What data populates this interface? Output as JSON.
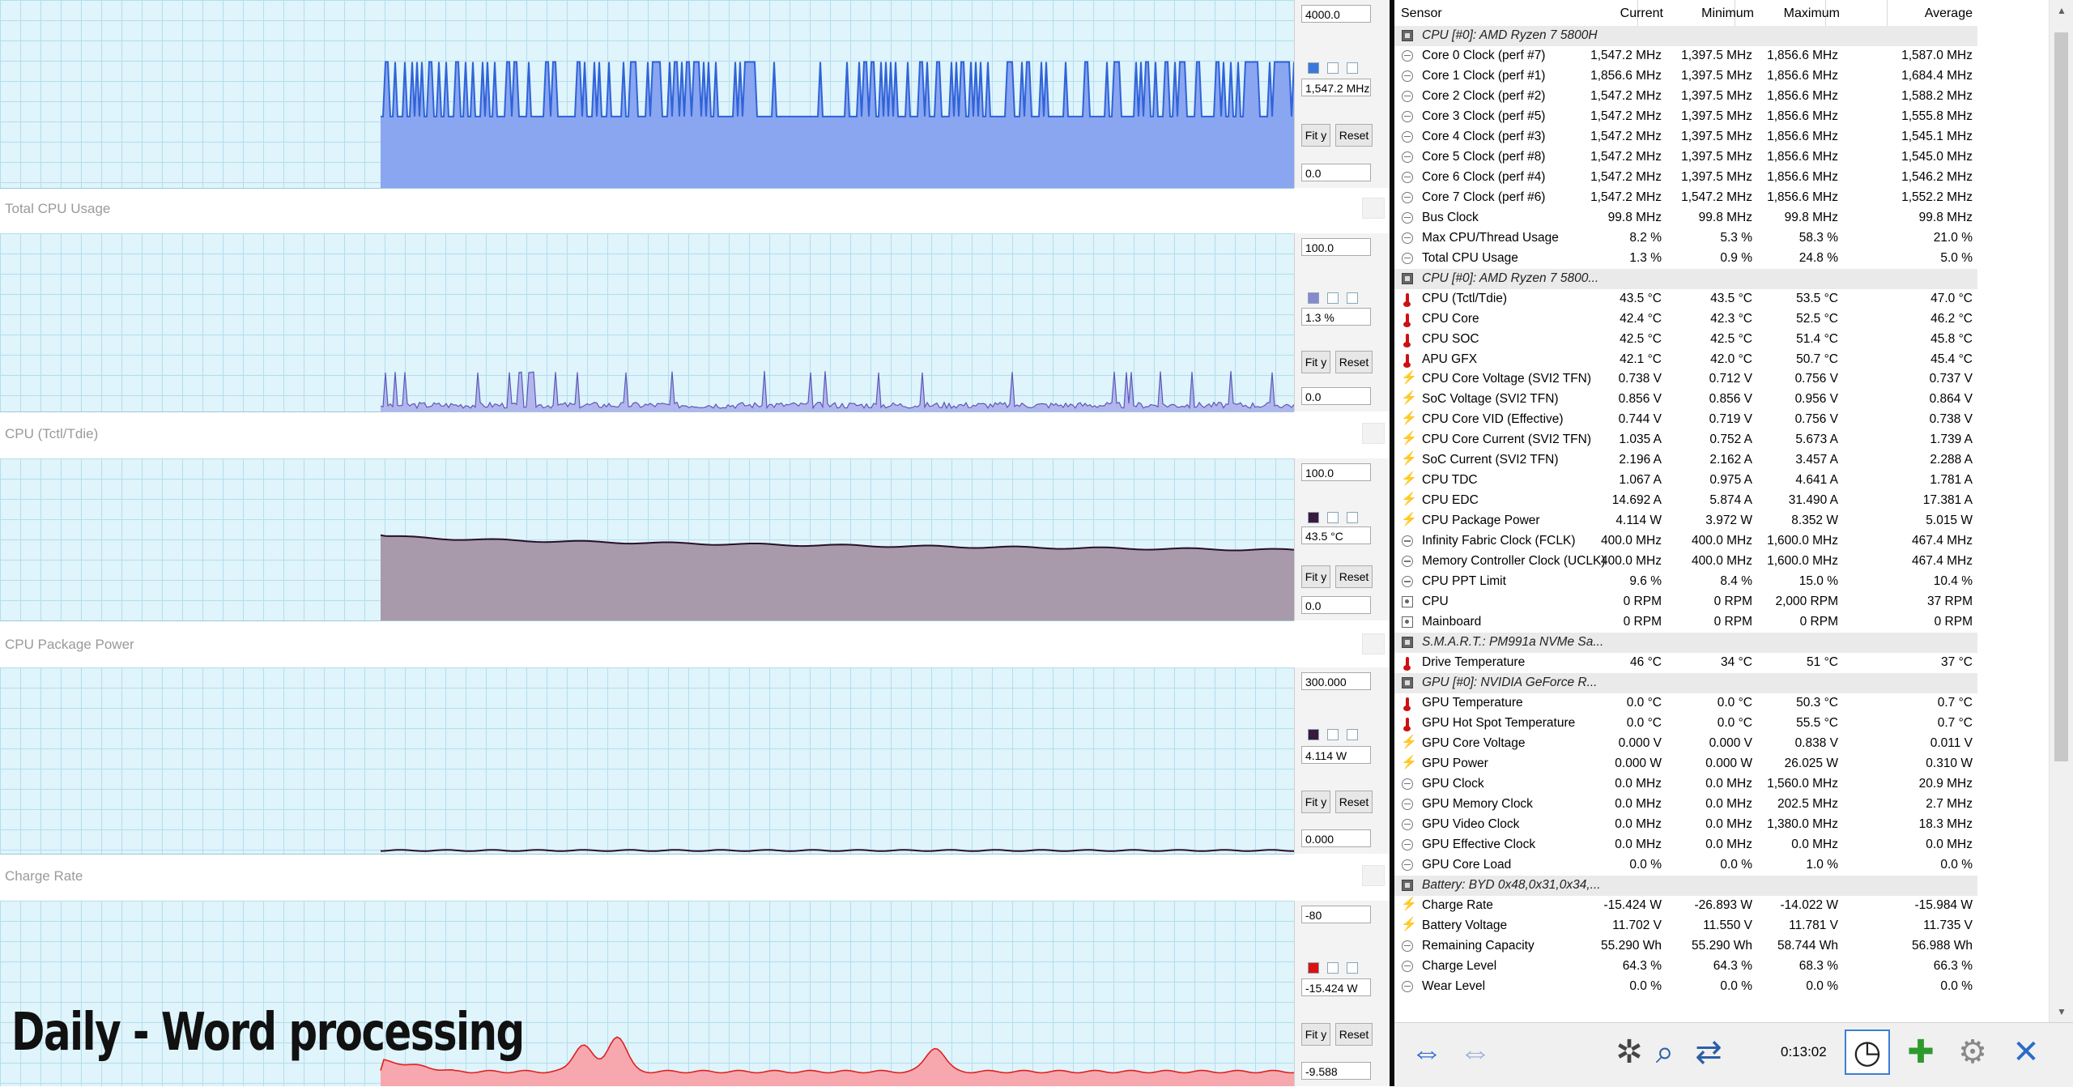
{
  "caption": "Daily - Word processing",
  "graphs": [
    {
      "title": "",
      "max": "4000.0",
      "current": "1,547.2 MHz",
      "min": "0.0",
      "color": "#3b78d8",
      "fit": "Fit y",
      "reset": "Reset"
    },
    {
      "title": "Total CPU Usage",
      "max": "100.0",
      "current": "1.3 %",
      "min": "0.0",
      "color": "#8888cc",
      "fit": "Fit y",
      "reset": "Reset"
    },
    {
      "title": "CPU (Tctl/Tdie)",
      "max": "100.0",
      "current": "43.5 °C",
      "min": "0.0",
      "color": "#3a1a3a",
      "fit": "Fit y",
      "reset": "Reset"
    },
    {
      "title": "CPU Package Power",
      "max": "300.000",
      "current": "4.114 W",
      "min": "0.000",
      "color": "#3a1a3a",
      "fit": "Fit y",
      "reset": "Reset"
    },
    {
      "title": "Charge Rate",
      "max": "-80",
      "current": "-15.424 W",
      "min": "-9.588",
      "color": "#dd1111",
      "fit": "Fit y",
      "reset": "Reset"
    }
  ],
  "table": {
    "headers": [
      "Sensor",
      "Current",
      "Minimum",
      "Maximum",
      "Average"
    ],
    "rows": [
      {
        "type": "group",
        "icon": "chip",
        "name": "CPU [#0]: AMD Ryzen 7 5800H"
      },
      {
        "icon": "clock",
        "name": "Core 0 Clock (perf #7)",
        "v": [
          "1,547.2 MHz",
          "1,397.5 MHz",
          "1,856.6 MHz",
          "1,587.0 MHz"
        ]
      },
      {
        "icon": "clock",
        "name": "Core 1 Clock (perf #1)",
        "v": [
          "1,856.6 MHz",
          "1,397.5 MHz",
          "1,856.6 MHz",
          "1,684.4 MHz"
        ]
      },
      {
        "icon": "clock",
        "name": "Core 2 Clock (perf #2)",
        "v": [
          "1,547.2 MHz",
          "1,397.5 MHz",
          "1,856.6 MHz",
          "1,588.2 MHz"
        ]
      },
      {
        "icon": "clock",
        "name": "Core 3 Clock (perf #5)",
        "v": [
          "1,547.2 MHz",
          "1,397.5 MHz",
          "1,856.6 MHz",
          "1,555.8 MHz"
        ]
      },
      {
        "icon": "clock",
        "name": "Core 4 Clock (perf #3)",
        "v": [
          "1,547.2 MHz",
          "1,397.5 MHz",
          "1,856.6 MHz",
          "1,545.1 MHz"
        ]
      },
      {
        "icon": "clock",
        "name": "Core 5 Clock (perf #8)",
        "v": [
          "1,547.2 MHz",
          "1,397.5 MHz",
          "1,856.6 MHz",
          "1,545.0 MHz"
        ]
      },
      {
        "icon": "clock",
        "name": "Core 6 Clock (perf #4)",
        "v": [
          "1,547.2 MHz",
          "1,397.5 MHz",
          "1,856.6 MHz",
          "1,546.2 MHz"
        ]
      },
      {
        "icon": "clock",
        "name": "Core 7 Clock (perf #6)",
        "v": [
          "1,547.2 MHz",
          "1,547.2 MHz",
          "1,856.6 MHz",
          "1,552.2 MHz"
        ]
      },
      {
        "icon": "clock",
        "name": "Bus Clock",
        "v": [
          "99.8 MHz",
          "99.8 MHz",
          "99.8 MHz",
          "99.8 MHz"
        ]
      },
      {
        "icon": "clock",
        "name": "Max CPU/Thread Usage",
        "v": [
          "8.2 %",
          "5.3 %",
          "58.3 %",
          "21.0 %"
        ]
      },
      {
        "icon": "clock",
        "name": "Total CPU Usage",
        "v": [
          "1.3 %",
          "0.9 %",
          "24.8 %",
          "5.0 %"
        ]
      },
      {
        "type": "group",
        "icon": "chip",
        "name": "CPU [#0]: AMD Ryzen 7 5800..."
      },
      {
        "icon": "temp",
        "name": "CPU (Tctl/Tdie)",
        "v": [
          "43.5 °C",
          "43.5 °C",
          "53.5 °C",
          "47.0 °C"
        ]
      },
      {
        "icon": "temp",
        "name": "CPU Core",
        "v": [
          "42.4 °C",
          "42.3 °C",
          "52.5 °C",
          "46.2 °C"
        ]
      },
      {
        "icon": "temp",
        "name": "CPU SOC",
        "v": [
          "42.5 °C",
          "42.5 °C",
          "51.4 °C",
          "45.8 °C"
        ]
      },
      {
        "icon": "temp",
        "name": "APU GFX",
        "v": [
          "42.1 °C",
          "42.0 °C",
          "50.7 °C",
          "45.4 °C"
        ]
      },
      {
        "icon": "volt",
        "name": "CPU Core Voltage (SVI2 TFN)",
        "v": [
          "0.738 V",
          "0.712 V",
          "0.756 V",
          "0.737 V"
        ]
      },
      {
        "icon": "volt",
        "name": "SoC Voltage (SVI2 TFN)",
        "v": [
          "0.856 V",
          "0.856 V",
          "0.956 V",
          "0.864 V"
        ]
      },
      {
        "icon": "volt",
        "name": "CPU Core VID (Effective)",
        "v": [
          "0.744 V",
          "0.719 V",
          "0.756 V",
          "0.738 V"
        ]
      },
      {
        "icon": "volt",
        "name": "CPU Core Current (SVI2 TFN)",
        "v": [
          "1.035 A",
          "0.752 A",
          "5.673 A",
          "1.739 A"
        ]
      },
      {
        "icon": "volt",
        "name": "SoC Current (SVI2 TFN)",
        "v": [
          "2.196 A",
          "2.162 A",
          "3.457 A",
          "2.288 A"
        ]
      },
      {
        "icon": "volt",
        "name": "CPU TDC",
        "v": [
          "1.067 A",
          "0.975 A",
          "4.641 A",
          "1.781 A"
        ]
      },
      {
        "icon": "volt",
        "name": "CPU EDC",
        "v": [
          "14.692 A",
          "5.874 A",
          "31.490 A",
          "17.381 A"
        ]
      },
      {
        "icon": "volt",
        "name": "CPU Package Power",
        "v": [
          "4.114 W",
          "3.972 W",
          "8.352 W",
          "5.015 W"
        ]
      },
      {
        "icon": "clock",
        "name": "Infinity Fabric Clock (FCLK)",
        "v": [
          "400.0 MHz",
          "400.0 MHz",
          "1,600.0 MHz",
          "467.4 MHz"
        ]
      },
      {
        "icon": "clock",
        "name": "Memory Controller Clock (UCLK)",
        "v": [
          "400.0 MHz",
          "400.0 MHz",
          "1,600.0 MHz",
          "467.4 MHz"
        ]
      },
      {
        "icon": "clock",
        "name": "CPU PPT Limit",
        "v": [
          "9.6 %",
          "8.4 %",
          "15.0 %",
          "10.4 %"
        ]
      },
      {
        "icon": "fan",
        "name": "CPU",
        "v": [
          "0 RPM",
          "0 RPM",
          "2,000 RPM",
          "37 RPM"
        ]
      },
      {
        "icon": "fan",
        "name": "Mainboard",
        "v": [
          "0 RPM",
          "0 RPM",
          "0 RPM",
          "0 RPM"
        ]
      },
      {
        "type": "group",
        "icon": "chip",
        "name": "S.M.A.R.T.: PM991a NVMe Sa..."
      },
      {
        "icon": "temp",
        "name": "Drive Temperature",
        "v": [
          "46 °C",
          "34 °C",
          "51 °C",
          "37 °C"
        ]
      },
      {
        "type": "group",
        "icon": "chip",
        "name": "GPU [#0]: NVIDIA GeForce R..."
      },
      {
        "icon": "temp",
        "name": "GPU Temperature",
        "v": [
          "0.0 °C",
          "0.0 °C",
          "50.3 °C",
          "0.7 °C"
        ]
      },
      {
        "icon": "temp",
        "name": "GPU Hot Spot Temperature",
        "v": [
          "0.0 °C",
          "0.0 °C",
          "55.5 °C",
          "0.7 °C"
        ]
      },
      {
        "icon": "volt",
        "name": "GPU Core Voltage",
        "v": [
          "0.000 V",
          "0.000 V",
          "0.838 V",
          "0.011 V"
        ]
      },
      {
        "icon": "volt",
        "name": "GPU Power",
        "v": [
          "0.000 W",
          "0.000 W",
          "26.025 W",
          "0.310 W"
        ]
      },
      {
        "icon": "clock",
        "name": "GPU Clock",
        "v": [
          "0.0 MHz",
          "0.0 MHz",
          "1,560.0 MHz",
          "20.9 MHz"
        ]
      },
      {
        "icon": "clock",
        "name": "GPU Memory Clock",
        "v": [
          "0.0 MHz",
          "0.0 MHz",
          "202.5 MHz",
          "2.7 MHz"
        ]
      },
      {
        "icon": "clock",
        "name": "GPU Video Clock",
        "v": [
          "0.0 MHz",
          "0.0 MHz",
          "1,380.0 MHz",
          "18.3 MHz"
        ]
      },
      {
        "icon": "clock",
        "name": "GPU Effective Clock",
        "v": [
          "0.0 MHz",
          "0.0 MHz",
          "0.0 MHz",
          "0.0 MHz"
        ]
      },
      {
        "icon": "clock",
        "name": "GPU Core Load",
        "v": [
          "0.0 %",
          "0.0 %",
          "1.0 %",
          "0.0 %"
        ]
      },
      {
        "type": "group",
        "icon": "chip",
        "name": "Battery: BYD  0x48,0x31,0x34,..."
      },
      {
        "icon": "volt",
        "name": "Charge Rate",
        "v": [
          "-15.424 W",
          "-26.893 W",
          "-14.022 W",
          "-15.984 W"
        ]
      },
      {
        "icon": "volt",
        "name": "Battery Voltage",
        "v": [
          "11.702 V",
          "11.550 V",
          "11.781 V",
          "11.735 V"
        ]
      },
      {
        "icon": "clock",
        "name": "Remaining Capacity",
        "v": [
          "55.290 Wh",
          "55.290 Wh",
          "58.744 Wh",
          "56.988 Wh"
        ]
      },
      {
        "icon": "clock",
        "name": "Charge Level",
        "v": [
          "64.3 %",
          "64.3 %",
          "68.3 %",
          "66.3 %"
        ]
      },
      {
        "icon": "clock",
        "name": "Wear Level",
        "v": [
          "0.0 %",
          "0.0 %",
          "0.0 %",
          "0.0 %"
        ]
      }
    ]
  },
  "footer": {
    "timer": "0:13:02",
    "buttons": [
      {
        "name": "nav-prev-next-icon",
        "glyph": "⇔",
        "color": "#2f6fd6"
      },
      {
        "name": "nav-collapse-icon",
        "glyph": "⇔",
        "color": "#9cb4d8"
      },
      {
        "name": "fan-settings-icon",
        "glyph": "✲",
        "color": "#444444"
      },
      {
        "name": "sensor-monitor-icon",
        "glyph": "⌕",
        "color": "#2d5fa8"
      },
      {
        "name": "network-icon",
        "glyph": "⇄",
        "color": "#2d5fa8"
      },
      {
        "name": "clock-icon",
        "glyph": "◷",
        "color": "#222222"
      },
      {
        "name": "add-report-icon",
        "glyph": "✚",
        "color": "#2e9a2e"
      },
      {
        "name": "settings-gear-icon",
        "glyph": "⚙",
        "color": "#888888"
      },
      {
        "name": "close-icon",
        "glyph": "✕",
        "color": "#2a6cc8"
      }
    ]
  }
}
